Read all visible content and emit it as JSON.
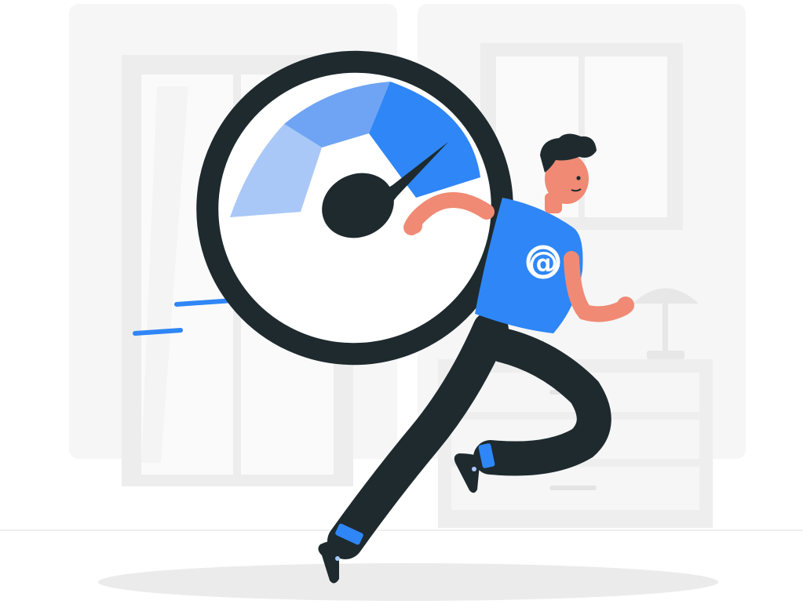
{
  "illustration": {
    "shirt_symbol": "@",
    "gauge_level": 0.72,
    "colors": {
      "accent_blue": "#2f86f6",
      "mid_blue": "#6fa4f4",
      "light_blue": "#a9c8f7",
      "dark": "#1e2a2e",
      "skin": "#f08a74",
      "background_gray": "#f3f3f3",
      "shadow_gray": "#ebebeb"
    },
    "icons": [
      "speedometer-icon",
      "at-sign-icon",
      "table-lamp-icon"
    ]
  }
}
